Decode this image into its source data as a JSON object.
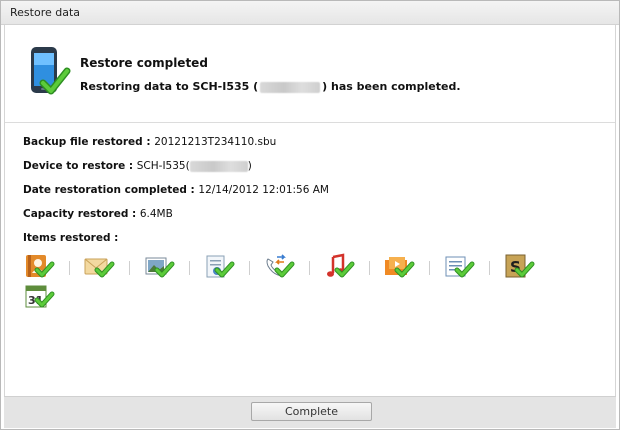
{
  "window": {
    "title": "Restore data"
  },
  "status": {
    "title": "Restore completed",
    "message_prefix": "Restoring data to SCH-I535 (",
    "message_suffix": ")  has been completed."
  },
  "details": {
    "backup_file": {
      "label": "Backup file restored : ",
      "value": "20121213T234110.sbu"
    },
    "device": {
      "label": "Device to restore : ",
      "value_prefix": "SCH-I535(",
      "value_suffix": ")"
    },
    "date": {
      "label": "Date restoration completed : ",
      "value": "12/14/2012 12:01:56 AM"
    },
    "capacity": {
      "label": "Capacity restored : ",
      "value": "6.4MB"
    },
    "items_label": "Items restored :"
  },
  "items": [
    {
      "icon": "contacts-icon"
    },
    {
      "icon": "messages-icon"
    },
    {
      "icon": "photos-icon"
    },
    {
      "icon": "settings-icon"
    },
    {
      "icon": "call-log-icon"
    },
    {
      "icon": "music-icon"
    },
    {
      "icon": "videos-icon"
    },
    {
      "icon": "memo-icon"
    },
    {
      "icon": "s-planner-icon"
    },
    {
      "icon": "calendar-icon"
    }
  ],
  "calendar_day": "31",
  "footer": {
    "complete_label": "Complete"
  },
  "colors": {
    "check_green": "#3aa62c",
    "title_bar": "#e9e9e9",
    "footer_bg": "#e4e4e4"
  }
}
